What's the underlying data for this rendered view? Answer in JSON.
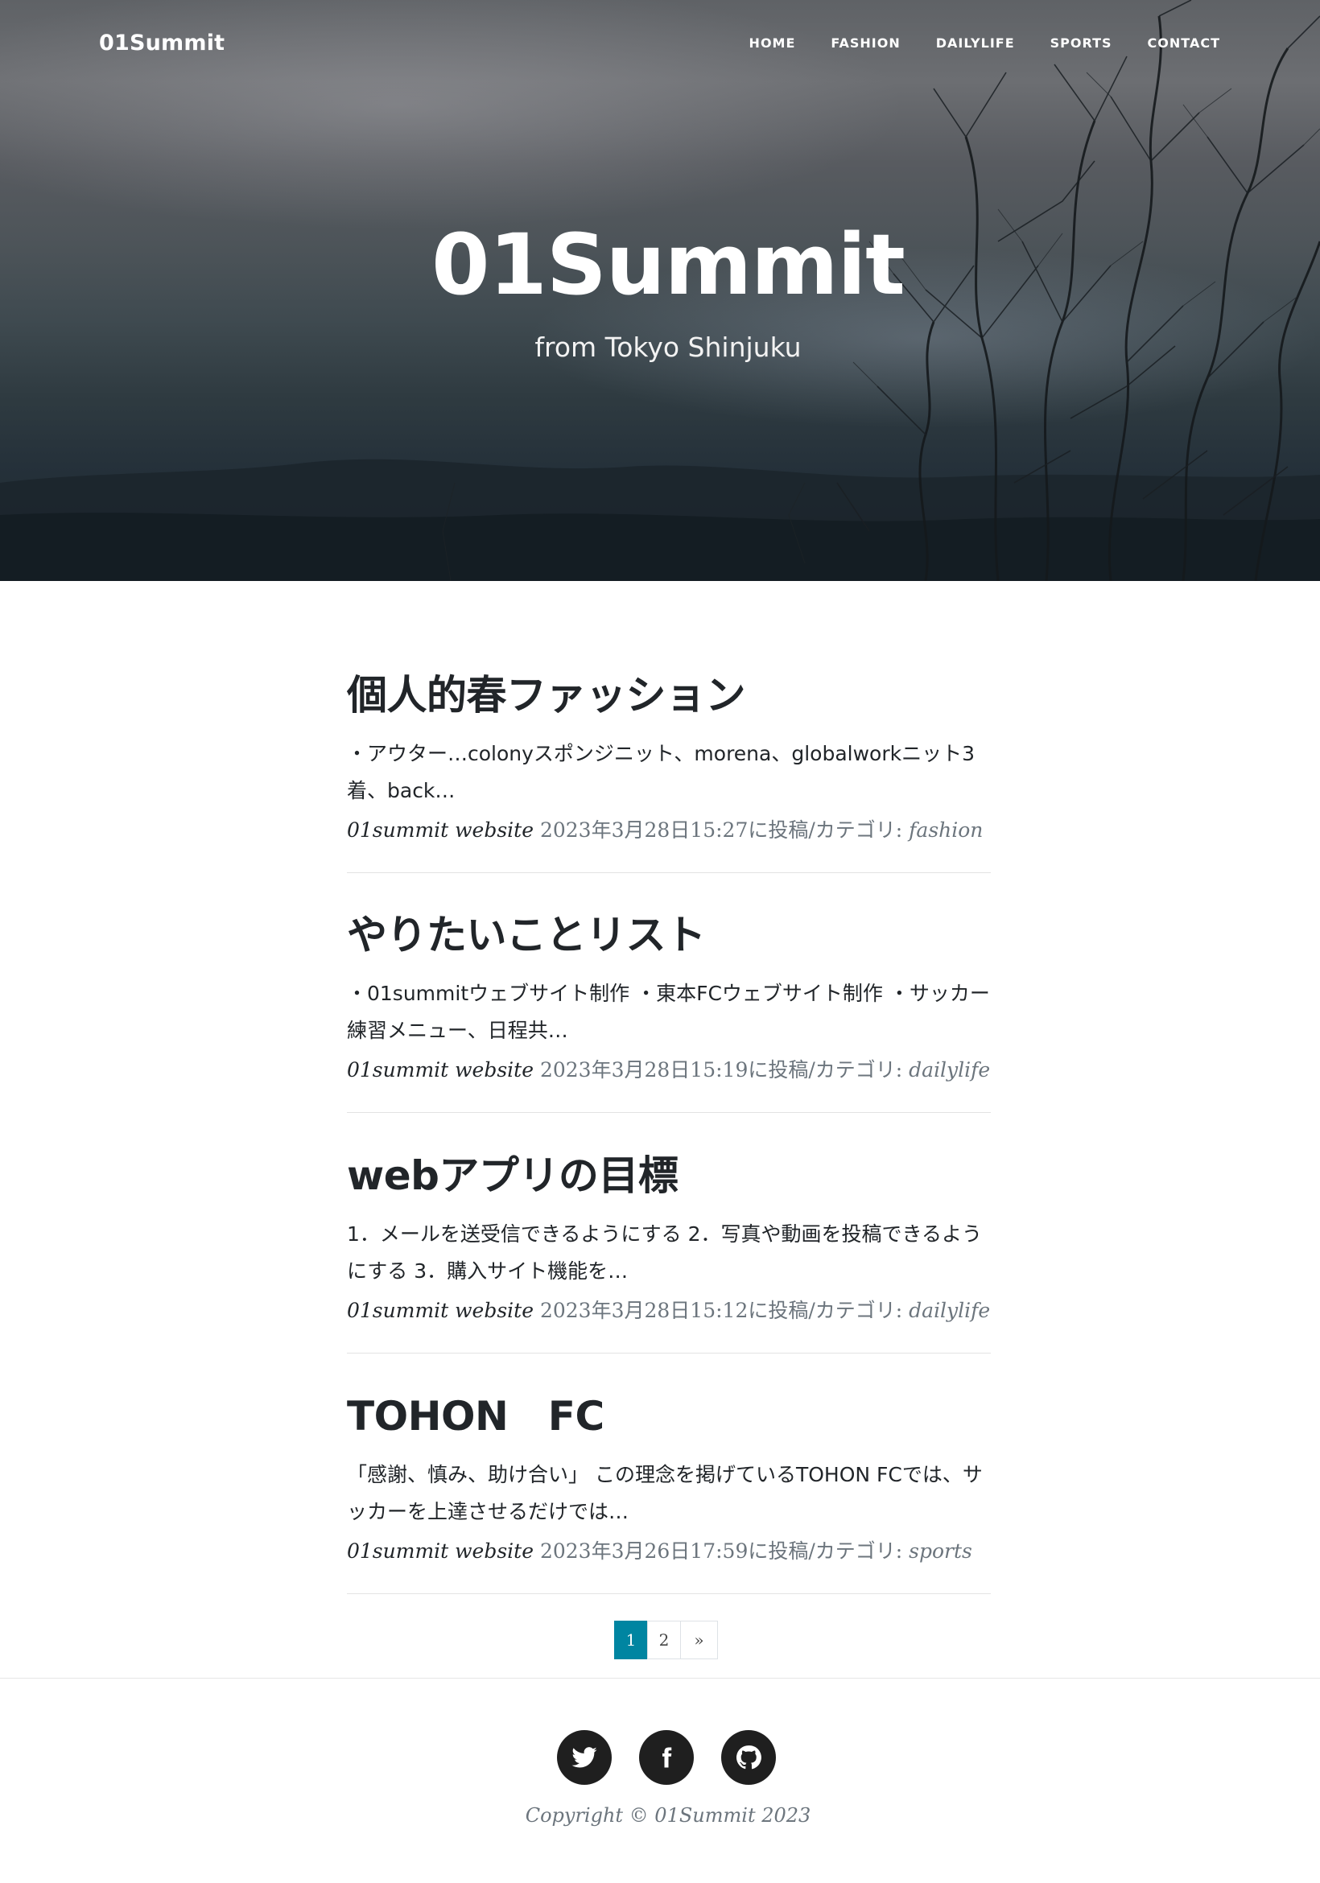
{
  "site": {
    "brand": "01Summit",
    "nav": [
      "HOME",
      "FASHION",
      "DAILYLIFE",
      "SPORTS",
      "CONTACT"
    ]
  },
  "hero": {
    "title": "01Summit",
    "subtitle": "from Tokyo Shinjuku"
  },
  "posts": [
    {
      "title": "個人的春ファッション",
      "excerpt": "・アウター…colonyスポンジニット、morena、globalworkニット3着、back…",
      "author": "01summit website",
      "posted": "2023年3月28日15:27に投稿/カテゴリ:",
      "category": "fashion"
    },
    {
      "title": "やりたいことリスト",
      "excerpt": "・01summitウェブサイト制作 ・東本FCウェブサイト制作 ・サッカー練習メニュー、日程共…",
      "author": "01summit website",
      "posted": "2023年3月28日15:19に投稿/カテゴリ:",
      "category": "dailylife"
    },
    {
      "title": "webアプリの目標",
      "excerpt": "1．メールを送受信できるようにする 2．写真や動画を投稿できるようにする 3．購入サイト機能を…",
      "author": "01summit website",
      "posted": "2023年3月28日15:12に投稿/カテゴリ:",
      "category": "dailylife"
    },
    {
      "title": "TOHON　FC",
      "excerpt": "「感謝、慎み、助け合い」 この理念を掲げているTOHON FCでは、サッカーを上達させるだけでは…",
      "author": "01summit website",
      "posted": "2023年3月26日17:59に投稿/カテゴリ:",
      "category": "sports"
    }
  ],
  "pagination": {
    "pages": [
      "1",
      "2"
    ],
    "current": "1",
    "next": "»"
  },
  "footer": {
    "social": [
      "twitter-icon",
      "facebook-icon",
      "github-icon"
    ],
    "copyright": "Copyright © 01Summit 2023"
  },
  "colors": {
    "accent": "#0085a1",
    "text": "#212529",
    "muted": "#6c757d"
  }
}
